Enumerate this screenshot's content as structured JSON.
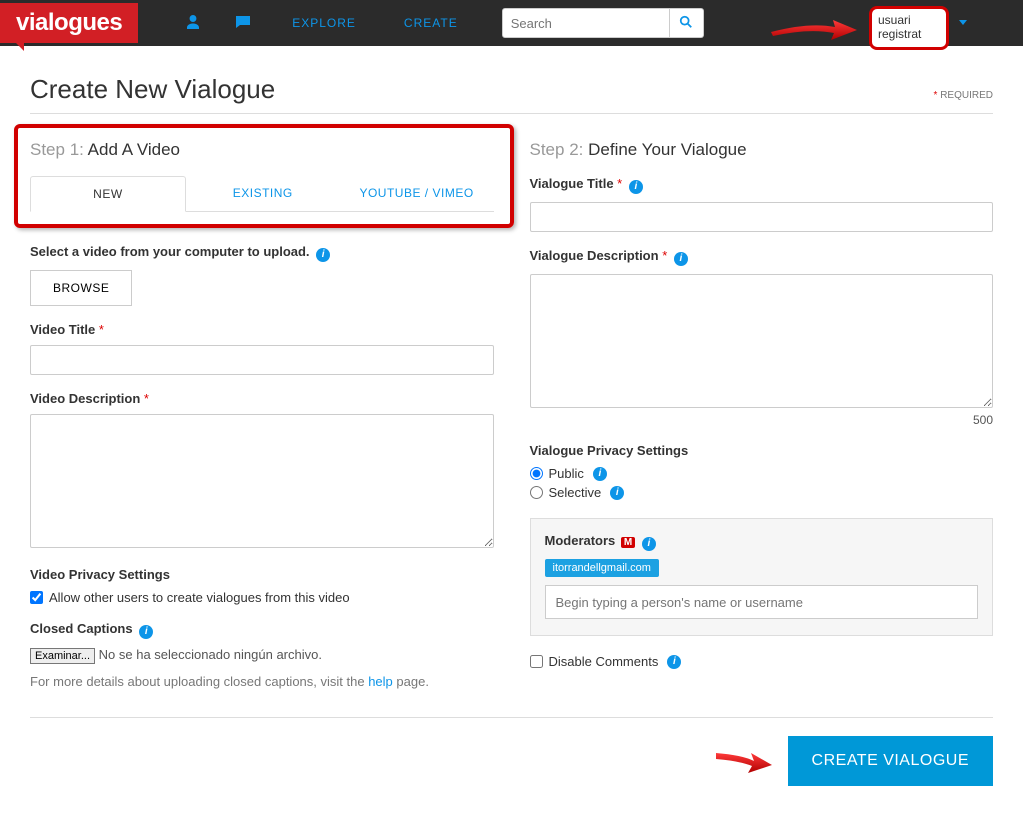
{
  "brand": "vialogues",
  "nav": {
    "explore": "EXPLORE",
    "create": "CREATE"
  },
  "search": {
    "placeholder": "Search"
  },
  "user_label": "usuari registrat",
  "page_title": "Create New Vialogue",
  "required_note": "REQUIRED",
  "step1": {
    "prefix": "Step 1:",
    "title": "Add A Video",
    "tabs": {
      "new": "NEW",
      "existing": "EXISTING",
      "yt": "YOUTUBE / VIMEO"
    },
    "select_hint": "Select a video from your computer to upload.",
    "browse": "BROWSE",
    "video_title_label": "Video Title",
    "video_desc_label": "Video Description",
    "privacy_label": "Video Privacy Settings",
    "privacy_cb": "Allow other users to create vialogues from this video",
    "cc_label": "Closed Captions",
    "cc_button": "Examinar...",
    "cc_note": "No se ha seleccionado ningún archivo.",
    "cc_help_pre": "For more details about uploading closed captions, visit the ",
    "cc_help_link": "help",
    "cc_help_post": " page."
  },
  "step2": {
    "prefix": "Step 2:",
    "title": "Define Your Vialogue",
    "vt_label": "Vialogue Title",
    "vd_label": "Vialogue Description",
    "char_count": "500",
    "privacy_label": "Vialogue Privacy Settings",
    "opt_public": "Public",
    "opt_selective": "Selective",
    "mod_label": "Moderators",
    "mod_badge": "M",
    "mod_chip": "itorrandellgmail.com",
    "mod_placeholder": "Begin typing a person's name or username",
    "disable_comments": "Disable Comments"
  },
  "submit": "CREATE VIALOGUE"
}
